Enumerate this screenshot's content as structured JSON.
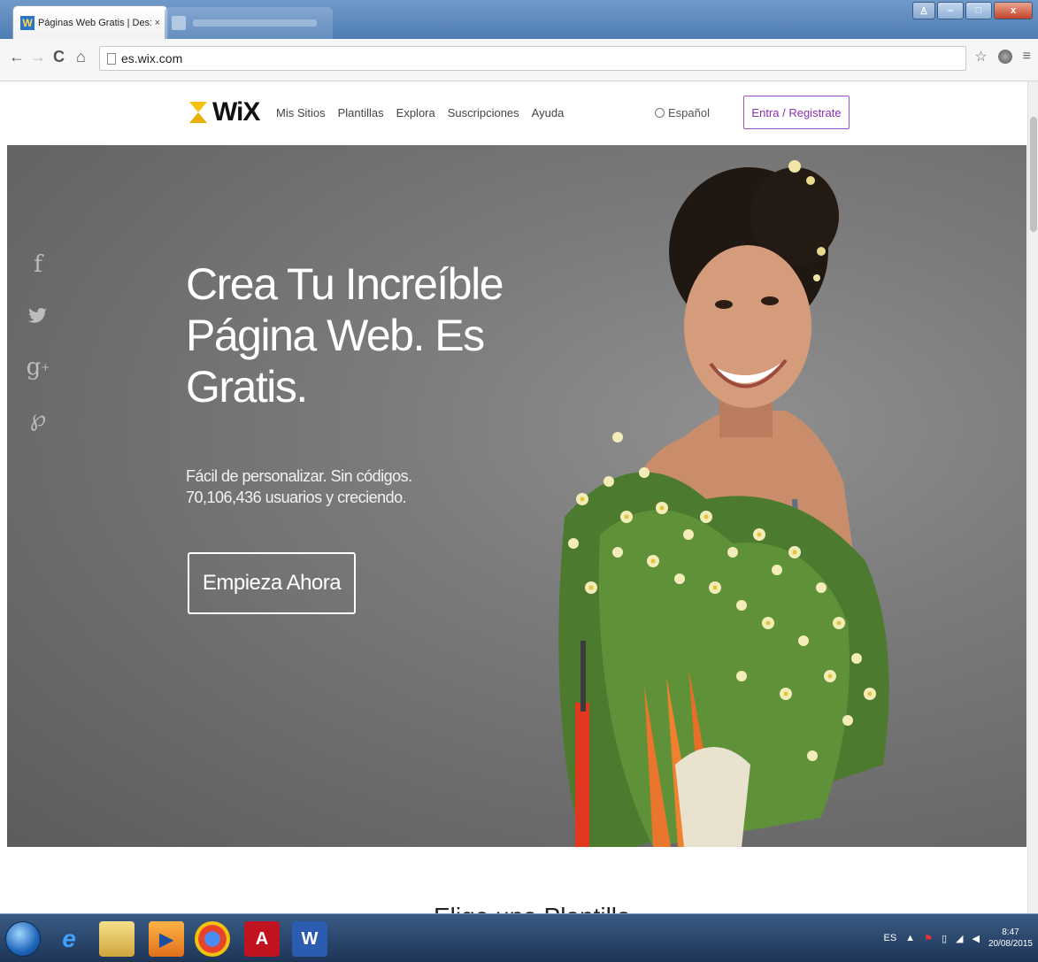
{
  "browser": {
    "tab_title": "Páginas Web Gratis | Des:",
    "tab_close": "×",
    "url": "es.wix.com",
    "window_buttons": {
      "minimize": "–",
      "maximize": "□",
      "close": "x"
    }
  },
  "site": {
    "logo_text": "WiX",
    "menu": [
      "Mis Sitios",
      "Plantillas",
      "Explora",
      "Suscripciones",
      "Ayuda"
    ],
    "language": "Español",
    "signin_label": "Entra / Registrate"
  },
  "hero": {
    "headline": "Crea Tu Increíble Página Web. Es Gratis.",
    "sub_line1": "Fácil de personalizar. Sin códigos.",
    "sub_line2": "70,106,436 usuarios y creciendo.",
    "cta_label": "Empieza Ahora",
    "social_icons": [
      "facebook-icon",
      "twitter-icon",
      "google-plus-icon",
      "pinterest-icon"
    ]
  },
  "below": {
    "section_title": "Elige una Plantilla"
  },
  "taskbar": {
    "lang": "ES",
    "time": "8:47",
    "date": "20/08/2015"
  },
  "colors": {
    "brand_accent": "#8b2fb3",
    "logo_yellow": "#f5c10e",
    "hero_bg": "#7b7b7b"
  }
}
